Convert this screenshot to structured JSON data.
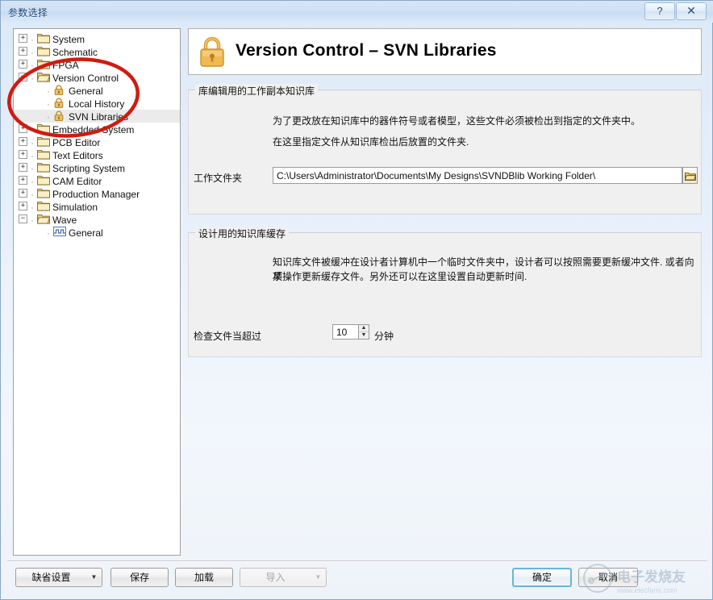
{
  "window": {
    "title": "参数选择",
    "help_label": "?",
    "close_label": "✕"
  },
  "tree": {
    "items": [
      {
        "label": "System",
        "indent": 0,
        "expander": "+",
        "icon": "folder-icon",
        "selected": false
      },
      {
        "label": "Schematic",
        "indent": 0,
        "expander": "+",
        "icon": "folder-icon",
        "selected": false
      },
      {
        "label": "FPGA",
        "indent": 0,
        "expander": "+",
        "icon": "folder-icon",
        "selected": false
      },
      {
        "label": "Version Control",
        "indent": 0,
        "expander": "−",
        "icon": "folder-open-icon",
        "selected": false
      },
      {
        "label": "General",
        "indent": 1,
        "expander": "",
        "icon": "lock-icon",
        "selected": false
      },
      {
        "label": "Local History",
        "indent": 1,
        "expander": "",
        "icon": "lock-icon",
        "selected": false
      },
      {
        "label": "SVN Libraries",
        "indent": 1,
        "expander": "",
        "icon": "lock-icon",
        "selected": true
      },
      {
        "label": "Embedded System",
        "indent": 0,
        "expander": "+",
        "icon": "folder-icon",
        "selected": false
      },
      {
        "label": "PCB Editor",
        "indent": 0,
        "expander": "+",
        "icon": "folder-icon",
        "selected": false
      },
      {
        "label": "Text Editors",
        "indent": 0,
        "expander": "+",
        "icon": "folder-icon",
        "selected": false
      },
      {
        "label": "Scripting System",
        "indent": 0,
        "expander": "+",
        "icon": "folder-icon",
        "selected": false
      },
      {
        "label": "CAM Editor",
        "indent": 0,
        "expander": "+",
        "icon": "folder-icon",
        "selected": false
      },
      {
        "label": "Production Manager",
        "indent": 0,
        "expander": "+",
        "icon": "folder-icon",
        "selected": false
      },
      {
        "label": "Simulation",
        "indent": 0,
        "expander": "+",
        "icon": "folder-icon",
        "selected": false
      },
      {
        "label": "Wave",
        "indent": 0,
        "expander": "−",
        "icon": "folder-open-icon",
        "selected": false
      },
      {
        "label": "General",
        "indent": 1,
        "expander": "",
        "icon": "wave-icon",
        "selected": false
      }
    ]
  },
  "page_header": {
    "title": "Version Control – SVN Libraries",
    "icon": "padlock-icon"
  },
  "group_working_copy": {
    "title": "库编辑用的工作副本知识库",
    "desc_line1": "为了更改放在知识库中的器件符号或者模型，这些文件必须被检出到指定的文件夹中。",
    "desc_line2": "在这里指定文件从知识库检出后放置的文件夹.",
    "field_label": "工作文件夹",
    "field_value": "C:\\Users\\Administrator\\Documents\\My Designs\\SVNDBlib Working Folder\\",
    "field_placeholder": "",
    "browse_icon": "open-folder-icon"
  },
  "group_cache": {
    "title": "设计用的知识库缓存",
    "desc_line1": "知识库文件被缓冲在设计者计算机中一个临时文件夹中，设计者可以按照需要更新缓冲文件. 或者向某",
    "desc_line2": "项操作更新缓存文件。另外还可以在这里设置自动更新时间.",
    "timeout_label": "检查文件当超过",
    "timeout_value": "10",
    "timeout_unit": "分钟",
    "spin_up": "▲",
    "spin_down": "▼"
  },
  "footer": {
    "defaults_label": "缺省设置",
    "defaults_arrow": "▼",
    "save_label": "保存",
    "load_label": "加载",
    "import_label": "导入",
    "import_arrow": "▼",
    "ok_label": "确定",
    "cancel_label": "取消"
  },
  "watermark": {
    "text": "电子发烧友",
    "url": "www.elecfans.com"
  },
  "annotation": {
    "shape": "red-ellipse",
    "color": "#d01a10"
  }
}
